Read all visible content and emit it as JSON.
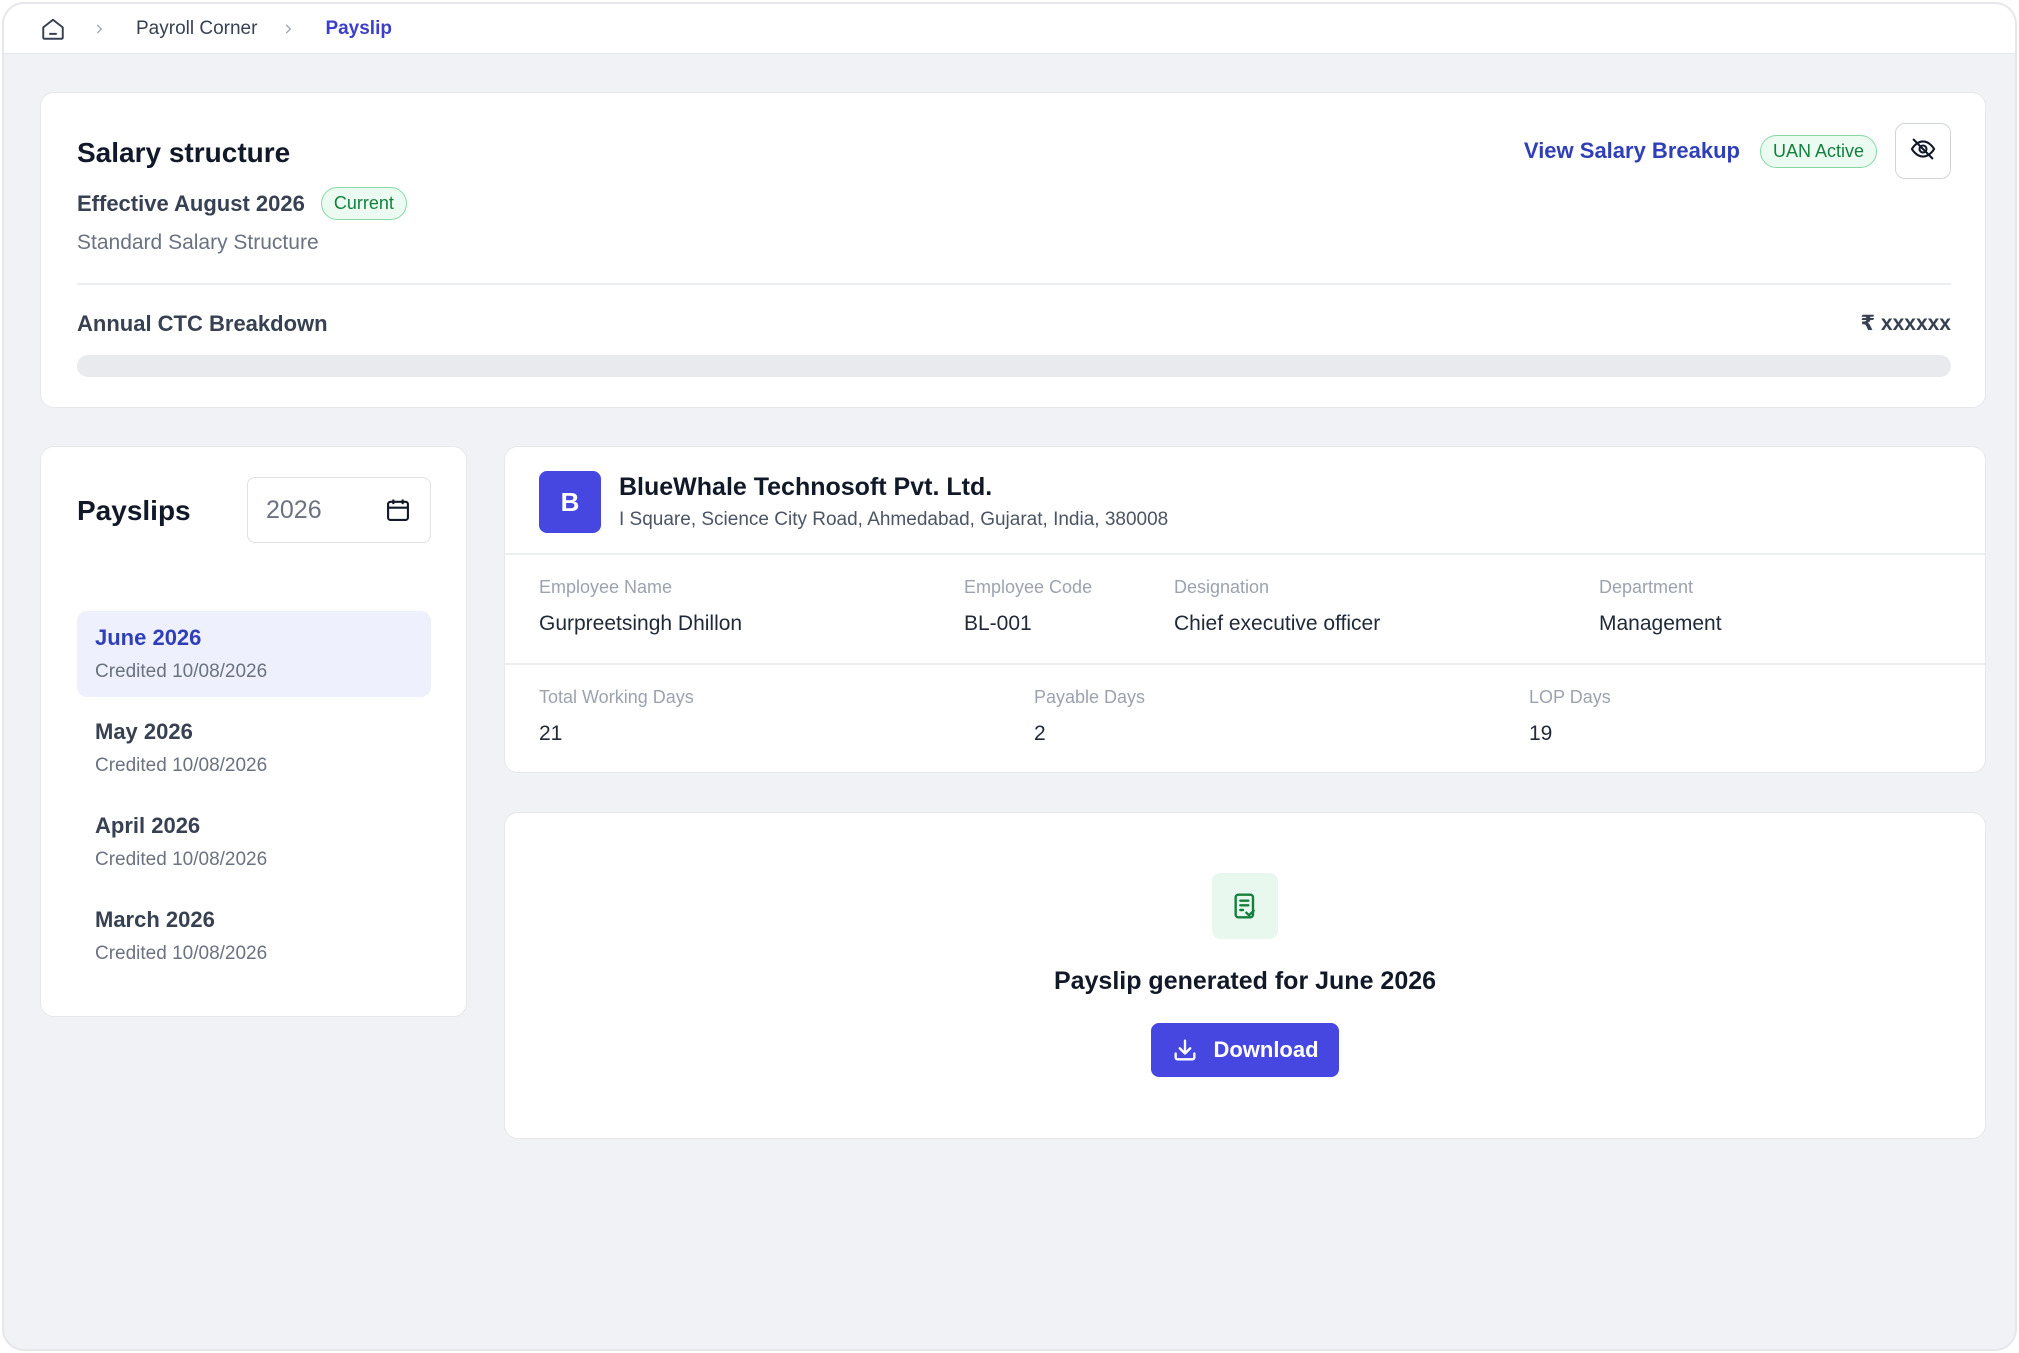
{
  "breadcrumb": {
    "items": [
      "Payroll Corner",
      "Payslip"
    ]
  },
  "salary": {
    "title": "Salary structure",
    "effective": "Effective August 2026",
    "current_badge": "Current",
    "structure_name": "Standard Salary Structure",
    "view_link": "View Salary Breakup",
    "uan_badge": "UAN Active",
    "ctc_label": "Annual CTC Breakdown",
    "ctc_value": "₹ xxxxxx"
  },
  "payslips": {
    "title": "Payslips",
    "year": "2026",
    "items": [
      {
        "month": "June 2026",
        "credited": "Credited 10/08/2026"
      },
      {
        "month": "May 2026",
        "credited": "Credited 10/08/2026"
      },
      {
        "month": "April 2026",
        "credited": "Credited 10/08/2026"
      },
      {
        "month": "March 2026",
        "credited": "Credited 10/08/2026"
      }
    ]
  },
  "company": {
    "logo_letter": "B",
    "name": "BlueWhale Technosoft Pvt. Ltd.",
    "address": "I Square, Science City Road, Ahmedabad, Gujarat, India, 380008"
  },
  "employee": {
    "name_label": "Employee Name",
    "name": "Gurpreetsingh Dhillon",
    "code_label": "Employee Code",
    "code": "BL-001",
    "designation_label": "Designation",
    "designation": "Chief executive officer",
    "department_label": "Department",
    "department": "Management"
  },
  "days": {
    "total_label": "Total Working Days",
    "total": "21",
    "payable_label": "Payable Days",
    "payable": "2",
    "lop_label": "LOP Days",
    "lop": "19"
  },
  "generated": {
    "message": "Payslip generated for June 2026",
    "download_label": "Download"
  },
  "colors": {
    "accent": "#4547e0",
    "link": "#2f3fb8",
    "success": "#15803d",
    "background": "#f1f2f5"
  }
}
